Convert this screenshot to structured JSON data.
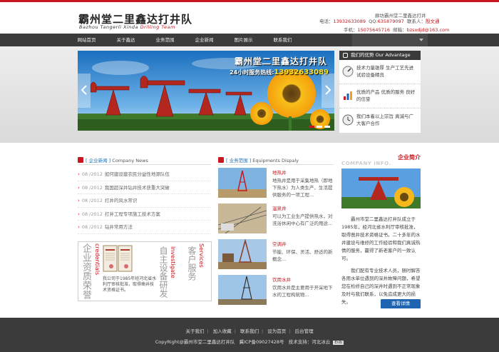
{
  "header": {
    "logo_cn": "霸州堂二里鑫达打井队",
    "logo_en_prefix": "Bazhou Tangerli Xinda",
    "logo_en_red": "Drilling Team",
    "slogan": "廊坊霸州堂二里鑫达打井",
    "phone_label": "电话：",
    "phone": "13932633089",
    "qq_label": "QQ:",
    "qq": "635879097",
    "contact_label": "联系人：",
    "contact_name": "殷文通",
    "mobile_label": "手机：",
    "mobile": "15075645716",
    "email_label": "邮箱：",
    "email": "bzsxdjd@163.com"
  },
  "nav": {
    "items": [
      "网站首页",
      "关于鑫达",
      "业务范围",
      "企业新闻",
      "图片展示",
      "联系我们"
    ]
  },
  "banner": {
    "title": "霸州堂二里鑫达打井队",
    "hotline_label": "24小时服务热线:",
    "hotline": "13932633089"
  },
  "advantage": {
    "title": "我们的优势 Our Advantage",
    "items": [
      {
        "text": "技术力量雄厚 生产工艺先进 试验设备精良"
      },
      {
        "text": "优质的产品 优质的服务 良好的信誉"
      },
      {
        "text": "我们本着以上宗旨 真诚与广大客户合作"
      }
    ]
  },
  "news": {
    "title_cn": "[ 企业新闻 ]",
    "title_en": "Company News",
    "items": [
      {
        "date": "08 /2012",
        "title": "如何建设建农民分益性地源队伍"
      },
      {
        "date": "08 /2012",
        "title": "我国超深井钻井技术获重大突破"
      },
      {
        "date": "08 /2012",
        "title": "打井的风水常识"
      },
      {
        "date": "08 /2012",
        "title": "打井工程专项施工技术方案"
      },
      {
        "date": "08 /2012",
        "title": "钻井常用方法"
      }
    ]
  },
  "credentials": {
    "vt1": "企业资质荣誉",
    "vt2": "credentials",
    "caption": "我公司于1985年经河北省水利厅审核批准，取得凿井技术资格证书。",
    "vt3": "自主设备研发",
    "vt4": "Investigate",
    "vt5": "客户服务",
    "vt6": "Services"
  },
  "services": {
    "title_cn": "[ 业务范围 ]",
    "title_en": "Equipments Dispaly",
    "items": [
      {
        "title": "地热井",
        "desc": "地热井是用于采集地热（即地下热水）为人类生产、生活提供服务的一项工程..."
      },
      {
        "title": "温泉井",
        "desc": "可以为工业生产提供热水，对洗浴休闲中心有广泛的用途..."
      },
      {
        "title": "空调井",
        "desc": "节能、环保、灵活、舒适的新概念..."
      },
      {
        "title": "饮用水井",
        "desc": "饮用水井是主要用于开采地下水的工程构筑物..."
      }
    ]
  },
  "company": {
    "title_cn": "企业简介",
    "title_en": "COMPANY INFO.",
    "text1": "霸州市堂二里鑫达打井队成立于1985年，经河北省水利厅审核批准，取得凿井技术资格证书。二十多年的水井建设与维修的工作经验和我们真诚热情的服务，赢得了新老客户的一致认可。",
    "text2": "我们配有专业技术人员，随时解答各用水单位遇到的深井故障问题，希望您在检修自己的深井时遇到不正常现象及时与我们联系，以免造成更大的损失。",
    "button": "查看详情"
  },
  "footer": {
    "links": [
      "关于我们",
      "加入收藏",
      "联系我们",
      "设为首页",
      "后台管理"
    ],
    "copyright": "CopyRight@霸州市堂二里鑫达打井队",
    "icp": "冀ICP备09027428号",
    "support": "技术支持：河北冰云",
    "badge": "Enlb"
  },
  "colors": {
    "accent": "#c8171e",
    "nav": "#3b3b3b",
    "link_blue": "#1a6fb3",
    "button_blue": "#1f64b0"
  }
}
